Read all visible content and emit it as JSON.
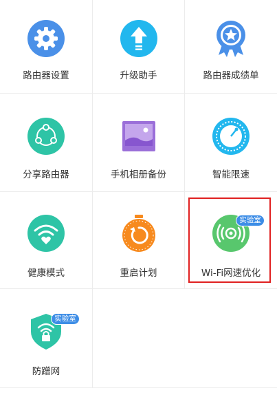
{
  "items": [
    {
      "label": "路由器设置",
      "icon": "gear-icon"
    },
    {
      "label": "升级助手",
      "icon": "upgrade-arrow-icon"
    },
    {
      "label": "路由器成绩单",
      "icon": "medal-star-icon"
    },
    {
      "label": "分享路由器",
      "icon": "share-icon"
    },
    {
      "label": "手机相册备份",
      "icon": "photo-album-icon"
    },
    {
      "label": "智能限速",
      "icon": "speed-limit-icon"
    },
    {
      "label": "健康模式",
      "icon": "wifi-heart-icon"
    },
    {
      "label": "重启计划",
      "icon": "restart-timer-icon"
    },
    {
      "label": "Wi-Fi网速优化",
      "icon": "wifi-signal-boost-icon",
      "badge": "实验室"
    },
    {
      "label": "防蹭网",
      "icon": "shield-lock-icon",
      "badge": "实验室"
    }
  ],
  "colors": {
    "blue": "#4a90e8",
    "cyan": "#22b7ee",
    "teal": "#2ec4a6",
    "purple": "#9b6fd9",
    "orange": "#f78a1e",
    "green": "#58c76d",
    "highlight": "#e02020"
  }
}
